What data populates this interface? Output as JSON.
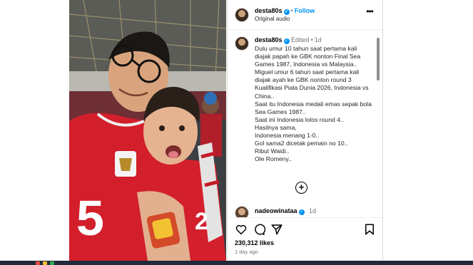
{
  "post": {
    "username": "desta80s",
    "follow_label": "Follow",
    "audio_label": "Original audio",
    "more_label": "•••"
  },
  "caption": {
    "username": "desta80s",
    "edited_label": "Edited",
    "age": "1d",
    "text": "Dulu umur 10 tahun saat pertama kali diajak papah ke GBK nonton Final Sea Games 1987, Indonesia vs Malaysia..\nMiguel umur 6 tahun saat pertama kali diajak ayah ke GBK nonton round 3 Kualifikasi Piala Dunia 2026, Indonesia vs China..\nSaat itu Indonesia medali emas sepak bola Sea Games 1987..\nSaat ini Indonesia lolos round 4..\nHasilnya sama,\nIndonesia menang 1-0..\nGol sama2 dicetak pemain no 10..\nRibut Waidi..\nOle Romeny.."
  },
  "load_more_label": "+",
  "reply": {
    "username": "nadeowinataa",
    "age": "1d"
  },
  "actions": {
    "likes": "230,312 likes",
    "time": "1 day ago"
  },
  "icons": {
    "like": "heart-icon",
    "comment": "comment-icon",
    "share": "share-icon",
    "save": "bookmark-icon",
    "more": "more-options-icon",
    "verified": "verified-badge-icon",
    "load_more": "plus-circle-icon"
  },
  "colors": {
    "accent": "#0095f6",
    "jersey": "#d6202a",
    "muted": "#737373"
  }
}
